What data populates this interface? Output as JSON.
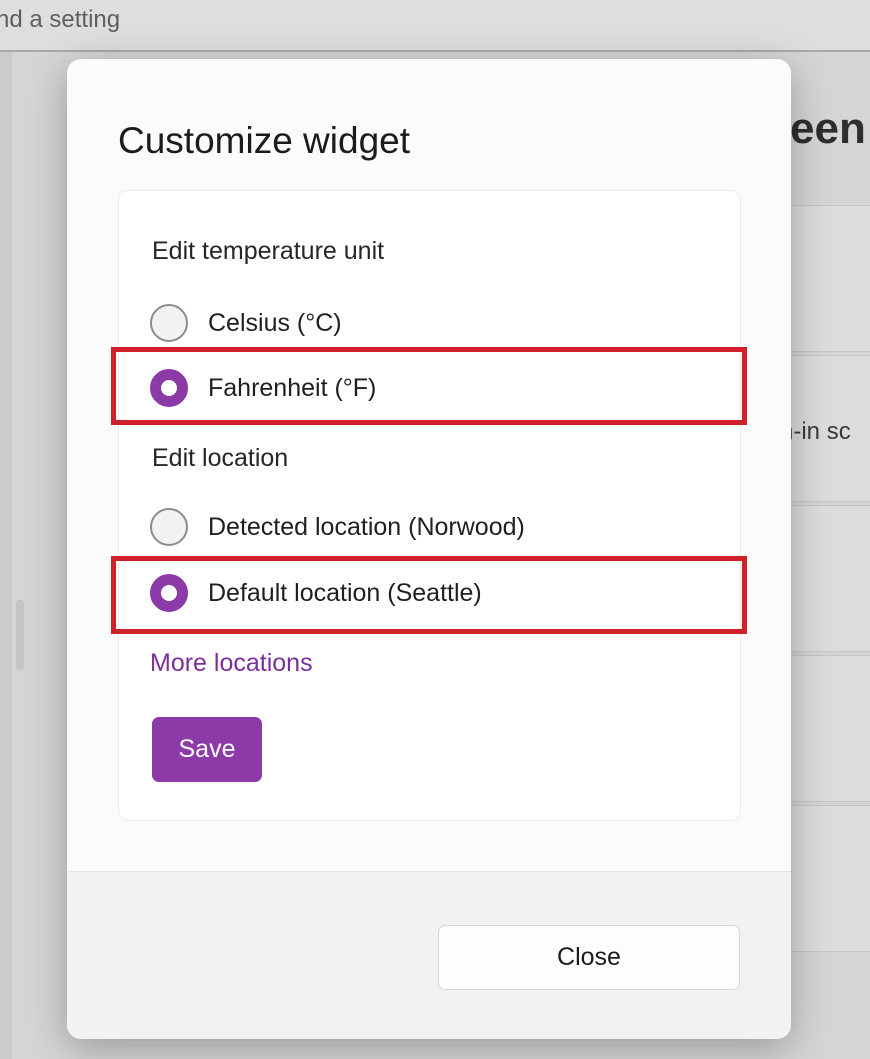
{
  "background": {
    "search_text": "nd a setting",
    "heading_fragment": "een",
    "card_text_fragment": "n-in sc"
  },
  "dialog": {
    "title": "Customize widget",
    "temperature": {
      "label": "Edit temperature unit",
      "options": [
        {
          "label": "Celsius (°C)",
          "selected": false
        },
        {
          "label": "Fahrenheit (°F)",
          "selected": true
        }
      ]
    },
    "location": {
      "label": "Edit location",
      "options": [
        {
          "label": "Detected location (Norwood)",
          "selected": false
        },
        {
          "label": "Default location (Seattle)",
          "selected": true
        }
      ]
    },
    "more_locations_link": "More locations",
    "save_label": "Save",
    "close_label": "Close"
  },
  "colors": {
    "accent": "#8b3aa8",
    "highlight": "#d0202a"
  }
}
